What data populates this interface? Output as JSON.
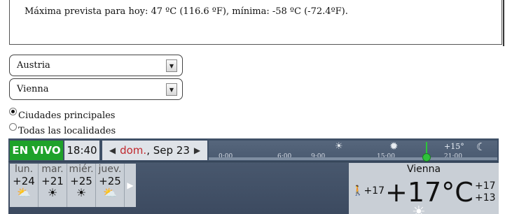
{
  "forecast_text": "Máxima prevista para hoy: 47 ºC (116.6 ºF), mínima: -58 ºC (-72.4ºF).",
  "selects": {
    "country": "Austria",
    "city": "Vienna"
  },
  "radios": {
    "main_cities": "Ciudades principales",
    "all_places": "Todas las localidades"
  },
  "widget": {
    "live_label": "EN VIVO",
    "clock": "18:40",
    "date_day": "dom.",
    "date_rest": ", Sep 23",
    "timeline_ticks": [
      "0:00",
      "6:00",
      "9:00",
      "15:00",
      "21:00"
    ],
    "timeline_high": "+15°",
    "days": [
      {
        "name": "lun.",
        "temp": "+24",
        "icon": "sun-cloud-icon"
      },
      {
        "name": "mar.",
        "temp": "+21",
        "icon": "sun-icon"
      },
      {
        "name": "miér.",
        "temp": "+25",
        "icon": "sun-icon"
      },
      {
        "name": "juev.",
        "temp": "+25",
        "icon": "sun-cloud-icon"
      }
    ],
    "city": {
      "name": "Vienna",
      "feels_like": "+17",
      "temperature": "+17°C",
      "high": "+17",
      "low": "+13"
    }
  },
  "colors": {
    "live_green": "#1fa22a",
    "weekday_red": "#c0282d",
    "widget_bg": "#3f5067"
  }
}
